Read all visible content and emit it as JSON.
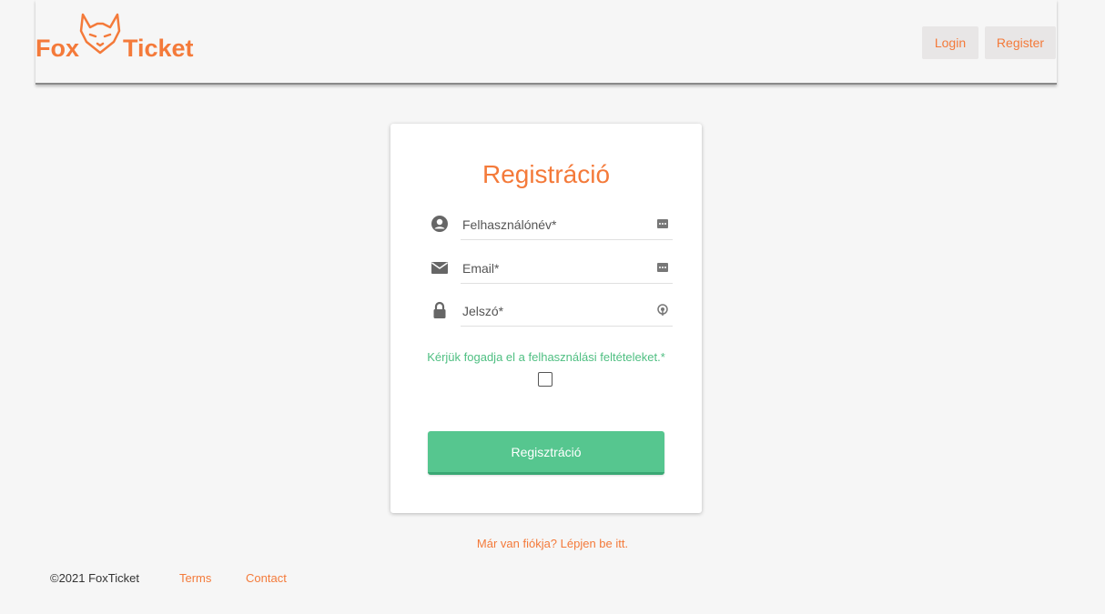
{
  "header": {
    "logo": {
      "word_left": "Fox",
      "word_right": "Ticket",
      "icon": "fox-head-icon"
    },
    "nav": {
      "login_label": "Login",
      "register_label": "Register"
    }
  },
  "form": {
    "title": "Registráció",
    "fields": [
      {
        "icon": "user-circle-icon",
        "placeholder": "Felhasználónév*",
        "value": "",
        "trailing_icon": "autofill-key-icon"
      },
      {
        "icon": "envelope-icon",
        "placeholder": "Email*",
        "value": "",
        "trailing_icon": "autofill-key-icon"
      },
      {
        "icon": "lock-icon",
        "placeholder": "Jelszó*",
        "value": "",
        "trailing_icon": "password-manager-icon"
      }
    ],
    "terms_text": "Kérjük fogadja el a felhasználási feltételeket.*",
    "terms_checked": false,
    "submit_label": "Regisztráció"
  },
  "login_link": "Már van fiókja? Lépjen be itt.",
  "footer": {
    "copyright": "©2021 FoxTicket",
    "terms": "Terms",
    "contact": "Contact"
  },
  "colors": {
    "brand": "#f47a3a",
    "accent": "#56c68f",
    "background": "#f6f6f6"
  }
}
